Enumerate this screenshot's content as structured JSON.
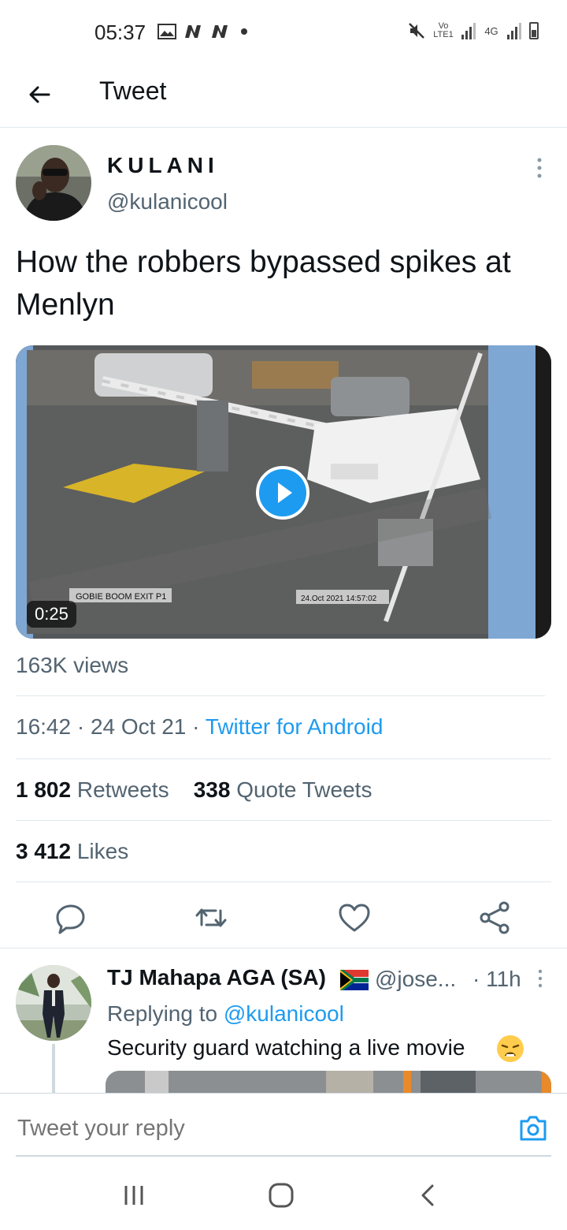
{
  "status_bar": {
    "time": "05:37",
    "network_volte": "Vo LTE1",
    "network_4g": "4G",
    "icons": [
      "image-icon",
      "n-icon",
      "n-icon",
      "dot-icon",
      "mute-icon",
      "signal-icon",
      "signal-icon",
      "battery-icon"
    ]
  },
  "header": {
    "title": "Tweet",
    "back_icon": "arrow-left-icon"
  },
  "tweet": {
    "author_name": "KULANI",
    "author_handle": "@kulanicool",
    "text": "How the robbers bypassed spikes at Menlyn",
    "media": {
      "type": "video",
      "duration": "0:25",
      "overlay_left": "GOBIE BOOM EXIT P1",
      "overlay_right": "24.Oct 2021  14:57:02"
    },
    "views": "163K views",
    "time": "16:42",
    "date": "24 Oct 21",
    "source": "Twitter for Android",
    "retweets_count": "1 802",
    "retweets_label": "Retweets",
    "quotes_count": "338",
    "quotes_label": "Quote Tweets",
    "likes_count": "3 412",
    "likes_label": "Likes",
    "actions": [
      "reply-icon",
      "retweet-icon",
      "like-icon",
      "share-icon"
    ]
  },
  "reply": {
    "name": "TJ Mahapa AGA (SA)",
    "handle": "@jose...",
    "time": "· 11h",
    "replying_prefix": "Replying to",
    "replying_to": "@kulanicool",
    "text": "Security guard watching a live movie"
  },
  "composer": {
    "placeholder": "Tweet your reply"
  },
  "colors": {
    "accent": "#1d9bf0",
    "text_primary": "#0f1419",
    "text_secondary": "#536471",
    "divider": "#e1e8ed"
  }
}
